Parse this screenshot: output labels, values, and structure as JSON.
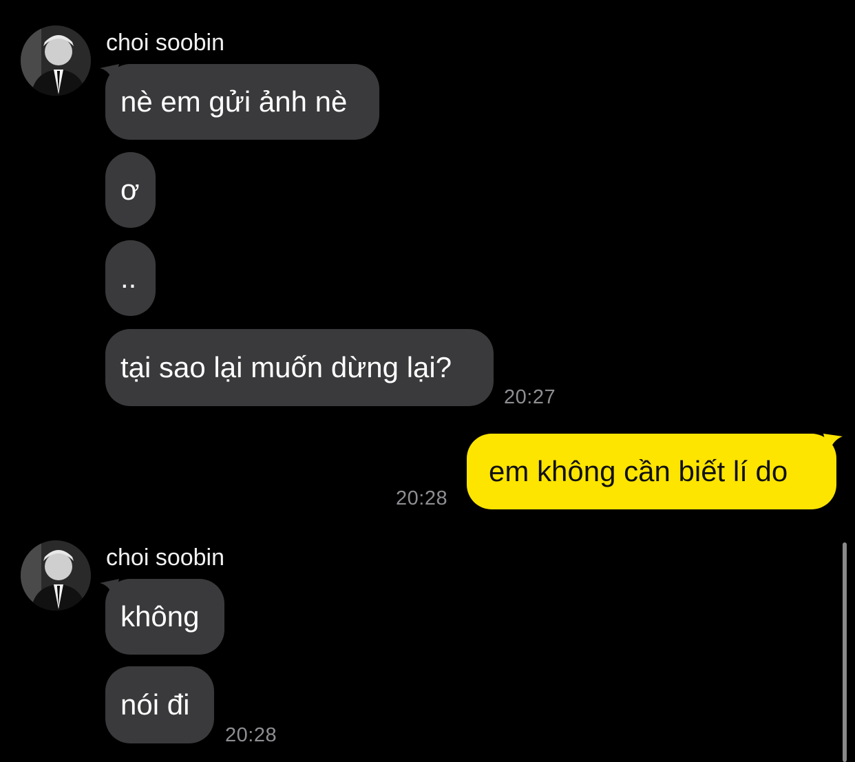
{
  "theme": {
    "background": "#000000",
    "incoming_bubble": "#3a3a3c",
    "outgoing_bubble": "#fee500",
    "timestamp_color": "#8e8e93"
  },
  "groups": [
    {
      "sender": "choi soobin",
      "avatar": "profile-photo",
      "messages": [
        "nè em gửi ảnh nè",
        "ơ",
        "..",
        "tại sao lại muốn dừng lại?"
      ],
      "time": "20:27"
    },
    {
      "outgoing": true,
      "messages": [
        "em không cần biết lí do"
      ],
      "time": "20:28"
    },
    {
      "sender": "choi soobin",
      "avatar": "profile-photo",
      "messages": [
        "không",
        "nói đi"
      ],
      "time": "20:28"
    }
  ]
}
